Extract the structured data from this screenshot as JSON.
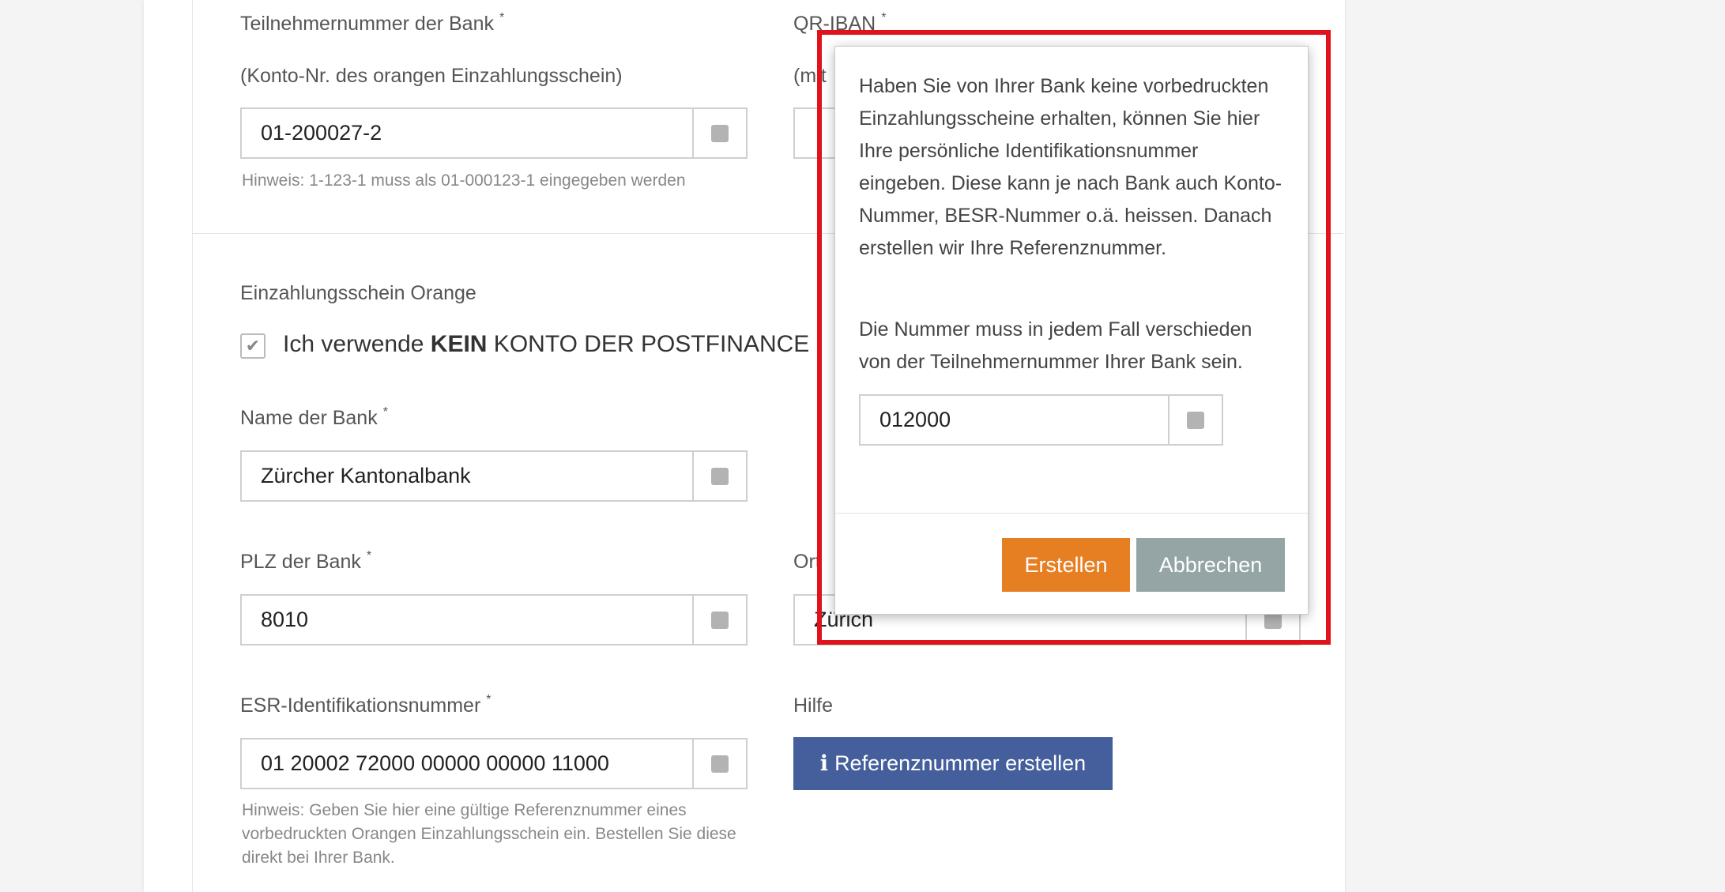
{
  "form": {
    "bank_number": {
      "label": "Teilnehmernummer der Bank",
      "required_mark": "*",
      "sublabel": "(Konto-Nr. des orangen Einzahlungsschein)",
      "value": "01-200027-2",
      "hint": "Hinweis: 1-123-1 muss als 01-000123-1 eingegeben werden"
    },
    "qr_iban": {
      "label": "QR-IBAN",
      "required_mark": "*",
      "sublabel": "(mit"
    },
    "section_title": "Einzahlungsschein Orange",
    "checkbox": {
      "text_prefix": "Ich verwende ",
      "text_bold": "KEIN",
      "text_suffix": " KONTO DER POSTFINANCE",
      "checked_glyph": "✔"
    },
    "bank_name": {
      "label": "Name der Bank",
      "required_mark": "*",
      "value": "Zürcher Kantonalbank"
    },
    "bank_zip": {
      "label": "PLZ der Bank",
      "required_mark": "*",
      "value": "8010"
    },
    "bank_city": {
      "label": "Ort",
      "value": "Zürich"
    },
    "esr_id": {
      "label": "ESR-Identifikationsnummer",
      "required_mark": "*",
      "value": "01 20002 72000 00000 00000 11000",
      "hint": "Hinweis: Geben Sie hier eine gültige Referenznummer eines vorbedruckten Orangen Einzahlungsschein ein. Bestellen Sie diese direkt bei Ihrer Bank."
    },
    "help": {
      "label": "Hilfe",
      "button_icon": "i",
      "button_label": "Referenznummer erstellen"
    }
  },
  "dialog": {
    "paragraph1": "Haben Sie von Ihrer Bank keine vorbedruckten Einzahlungsscheine erhalten, können Sie hier Ihre persönliche Identifikationsnummer eingeben. Diese kann je nach Bank auch Konto-Nummer, BESR-Nummer o.ä. heissen. Danach erstellen wir Ihre Referenznummer.",
    "paragraph2": "Die Nummer muss in jedem Fall verschieden von der Teilnehmernummer Ihrer Bank sein.",
    "input_value": "012000",
    "create_label": "Erstellen",
    "cancel_label": "Abbrechen"
  },
  "colors": {
    "create_button": "#e67e22",
    "cancel_button": "#95a5a6",
    "help_button": "#445f9c",
    "highlight": "#e0121b"
  },
  "icons": {
    "field_addon": "square-icon",
    "checkbox": "check-icon",
    "help_button": "info-icon"
  }
}
